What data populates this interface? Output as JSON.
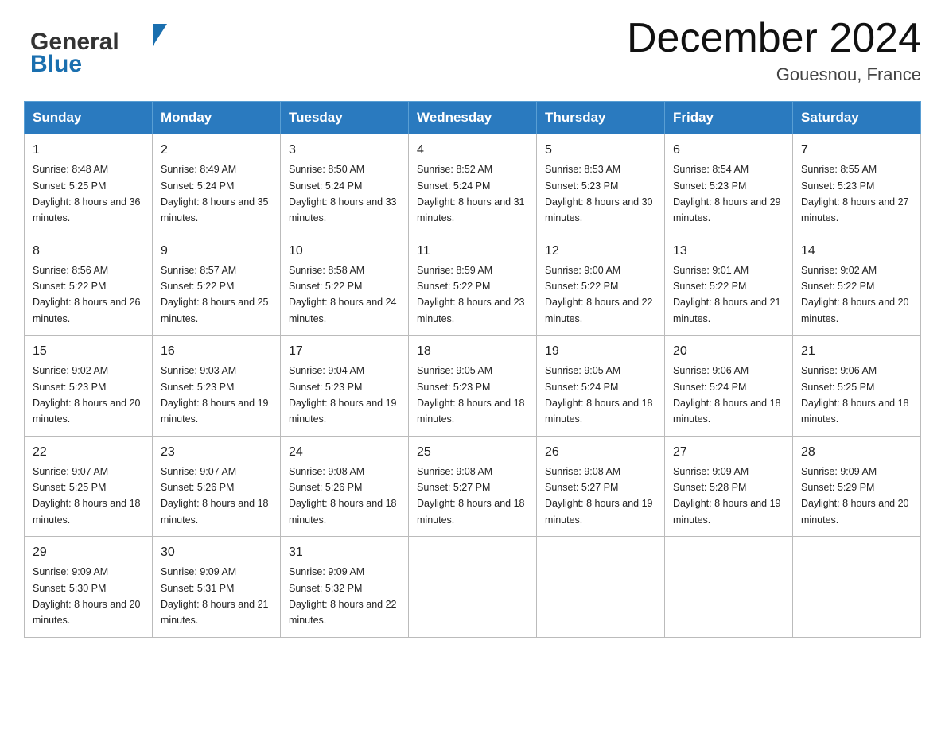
{
  "header": {
    "logo_general": "General",
    "logo_blue": "Blue",
    "month_title": "December 2024",
    "location": "Gouesnou, France"
  },
  "weekdays": [
    "Sunday",
    "Monday",
    "Tuesday",
    "Wednesday",
    "Thursday",
    "Friday",
    "Saturday"
  ],
  "weeks": [
    [
      {
        "day": "1",
        "sunrise": "8:48 AM",
        "sunset": "5:25 PM",
        "daylight": "8 hours and 36 minutes."
      },
      {
        "day": "2",
        "sunrise": "8:49 AM",
        "sunset": "5:24 PM",
        "daylight": "8 hours and 35 minutes."
      },
      {
        "day": "3",
        "sunrise": "8:50 AM",
        "sunset": "5:24 PM",
        "daylight": "8 hours and 33 minutes."
      },
      {
        "day": "4",
        "sunrise": "8:52 AM",
        "sunset": "5:24 PM",
        "daylight": "8 hours and 31 minutes."
      },
      {
        "day": "5",
        "sunrise": "8:53 AM",
        "sunset": "5:23 PM",
        "daylight": "8 hours and 30 minutes."
      },
      {
        "day": "6",
        "sunrise": "8:54 AM",
        "sunset": "5:23 PM",
        "daylight": "8 hours and 29 minutes."
      },
      {
        "day": "7",
        "sunrise": "8:55 AM",
        "sunset": "5:23 PM",
        "daylight": "8 hours and 27 minutes."
      }
    ],
    [
      {
        "day": "8",
        "sunrise": "8:56 AM",
        "sunset": "5:22 PM",
        "daylight": "8 hours and 26 minutes."
      },
      {
        "day": "9",
        "sunrise": "8:57 AM",
        "sunset": "5:22 PM",
        "daylight": "8 hours and 25 minutes."
      },
      {
        "day": "10",
        "sunrise": "8:58 AM",
        "sunset": "5:22 PM",
        "daylight": "8 hours and 24 minutes."
      },
      {
        "day": "11",
        "sunrise": "8:59 AM",
        "sunset": "5:22 PM",
        "daylight": "8 hours and 23 minutes."
      },
      {
        "day": "12",
        "sunrise": "9:00 AM",
        "sunset": "5:22 PM",
        "daylight": "8 hours and 22 minutes."
      },
      {
        "day": "13",
        "sunrise": "9:01 AM",
        "sunset": "5:22 PM",
        "daylight": "8 hours and 21 minutes."
      },
      {
        "day": "14",
        "sunrise": "9:02 AM",
        "sunset": "5:22 PM",
        "daylight": "8 hours and 20 minutes."
      }
    ],
    [
      {
        "day": "15",
        "sunrise": "9:02 AM",
        "sunset": "5:23 PM",
        "daylight": "8 hours and 20 minutes."
      },
      {
        "day": "16",
        "sunrise": "9:03 AM",
        "sunset": "5:23 PM",
        "daylight": "8 hours and 19 minutes."
      },
      {
        "day": "17",
        "sunrise": "9:04 AM",
        "sunset": "5:23 PM",
        "daylight": "8 hours and 19 minutes."
      },
      {
        "day": "18",
        "sunrise": "9:05 AM",
        "sunset": "5:23 PM",
        "daylight": "8 hours and 18 minutes."
      },
      {
        "day": "19",
        "sunrise": "9:05 AM",
        "sunset": "5:24 PM",
        "daylight": "8 hours and 18 minutes."
      },
      {
        "day": "20",
        "sunrise": "9:06 AM",
        "sunset": "5:24 PM",
        "daylight": "8 hours and 18 minutes."
      },
      {
        "day": "21",
        "sunrise": "9:06 AM",
        "sunset": "5:25 PM",
        "daylight": "8 hours and 18 minutes."
      }
    ],
    [
      {
        "day": "22",
        "sunrise": "9:07 AM",
        "sunset": "5:25 PM",
        "daylight": "8 hours and 18 minutes."
      },
      {
        "day": "23",
        "sunrise": "9:07 AM",
        "sunset": "5:26 PM",
        "daylight": "8 hours and 18 minutes."
      },
      {
        "day": "24",
        "sunrise": "9:08 AM",
        "sunset": "5:26 PM",
        "daylight": "8 hours and 18 minutes."
      },
      {
        "day": "25",
        "sunrise": "9:08 AM",
        "sunset": "5:27 PM",
        "daylight": "8 hours and 18 minutes."
      },
      {
        "day": "26",
        "sunrise": "9:08 AM",
        "sunset": "5:27 PM",
        "daylight": "8 hours and 19 minutes."
      },
      {
        "day": "27",
        "sunrise": "9:09 AM",
        "sunset": "5:28 PM",
        "daylight": "8 hours and 19 minutes."
      },
      {
        "day": "28",
        "sunrise": "9:09 AM",
        "sunset": "5:29 PM",
        "daylight": "8 hours and 20 minutes."
      }
    ],
    [
      {
        "day": "29",
        "sunrise": "9:09 AM",
        "sunset": "5:30 PM",
        "daylight": "8 hours and 20 minutes."
      },
      {
        "day": "30",
        "sunrise": "9:09 AM",
        "sunset": "5:31 PM",
        "daylight": "8 hours and 21 minutes."
      },
      {
        "day": "31",
        "sunrise": "9:09 AM",
        "sunset": "5:32 PM",
        "daylight": "8 hours and 22 minutes."
      },
      null,
      null,
      null,
      null
    ]
  ],
  "labels": {
    "sunrise": "Sunrise:",
    "sunset": "Sunset:",
    "daylight": "Daylight:"
  }
}
